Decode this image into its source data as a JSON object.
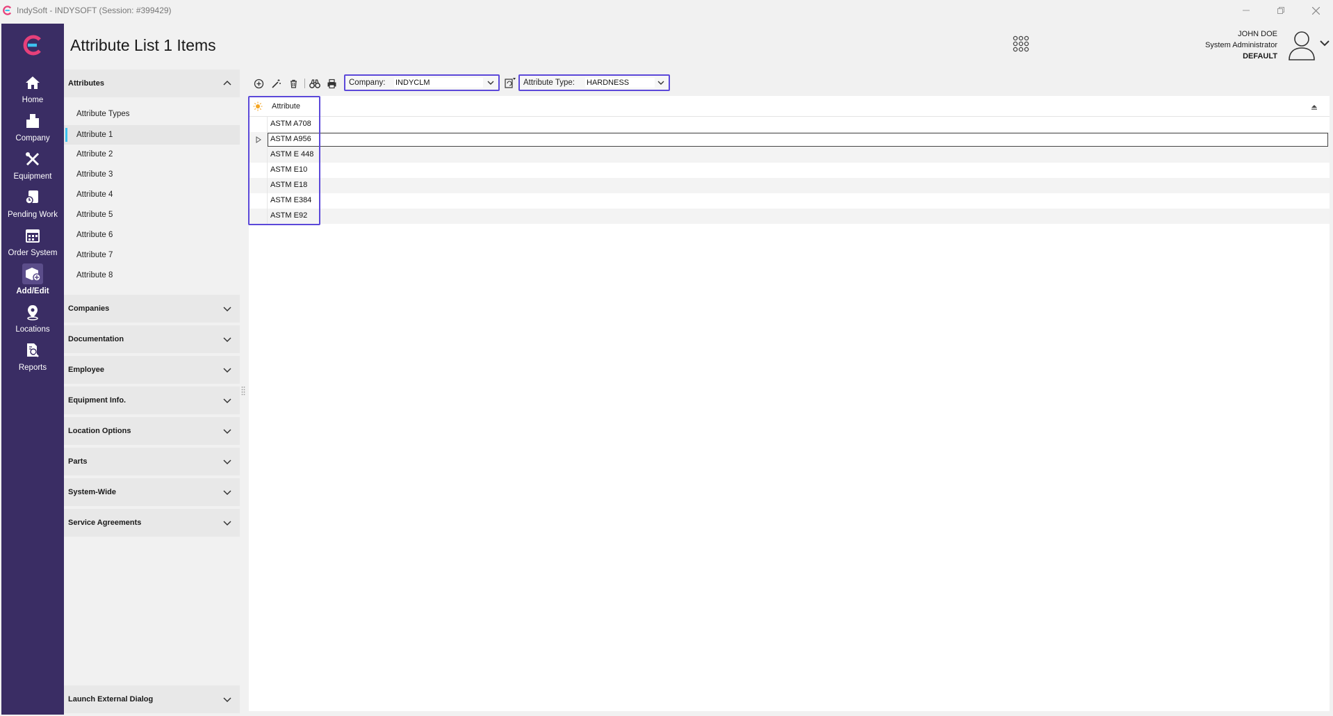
{
  "window": {
    "title": "IndySoft - INDYSOFT (Session: #399429)",
    "controls": [
      "minimize",
      "restore",
      "close"
    ]
  },
  "colors": {
    "nav_bg": "#3a2d64",
    "accent_highlight": "#5b48d9",
    "selected_marker": "#3cc2f0",
    "logo_pink": "#e7407a",
    "logo_cyan": "#3cc2f0"
  },
  "nav": {
    "items": [
      {
        "label": "Home",
        "icon": "home-icon"
      },
      {
        "label": "Company",
        "icon": "company-icon"
      },
      {
        "label": "Equipment",
        "icon": "equipment-icon"
      },
      {
        "label": "Pending Work",
        "icon": "pending-work-icon"
      },
      {
        "label": "Order System",
        "icon": "order-system-icon"
      },
      {
        "label": "Add/Edit",
        "icon": "add-edit-icon",
        "active": true
      },
      {
        "label": "Locations",
        "icon": "locations-icon"
      },
      {
        "label": "Reports",
        "icon": "reports-icon"
      }
    ]
  },
  "header": {
    "page_title": "Attribute List 1 Items",
    "user_name": "JOHN DOE",
    "user_role": "System Administrator",
    "user_database": "DEFAULT"
  },
  "sidepanel": {
    "attributes": {
      "title": "Attributes",
      "items": [
        "Attribute Types",
        "Attribute 1",
        "Attribute 2",
        "Attribute 3",
        "Attribute 4",
        "Attribute 5",
        "Attribute 6",
        "Attribute 7",
        "Attribute 8"
      ],
      "selected": "Attribute 1"
    },
    "sections": [
      "Companies",
      "Documentation",
      "Employee",
      "Equipment Info.",
      "Location Options",
      "Parts",
      "System-Wide",
      "Service Agreements"
    ],
    "footer_section": "Launch External Dialog"
  },
  "toolbar": {
    "company_label": "Company:",
    "company_value": "INDYCLM",
    "attribute_type_label": "Attribute Type:",
    "attribute_type_value": "HARDNESS"
  },
  "grid": {
    "column": "Attribute",
    "rows": [
      "ASTM A708",
      "ASTM A956",
      "ASTM E 448",
      "ASTM E10",
      "ASTM E18",
      "ASTM E384",
      "ASTM E92"
    ],
    "focused_row": "ASTM A956"
  }
}
